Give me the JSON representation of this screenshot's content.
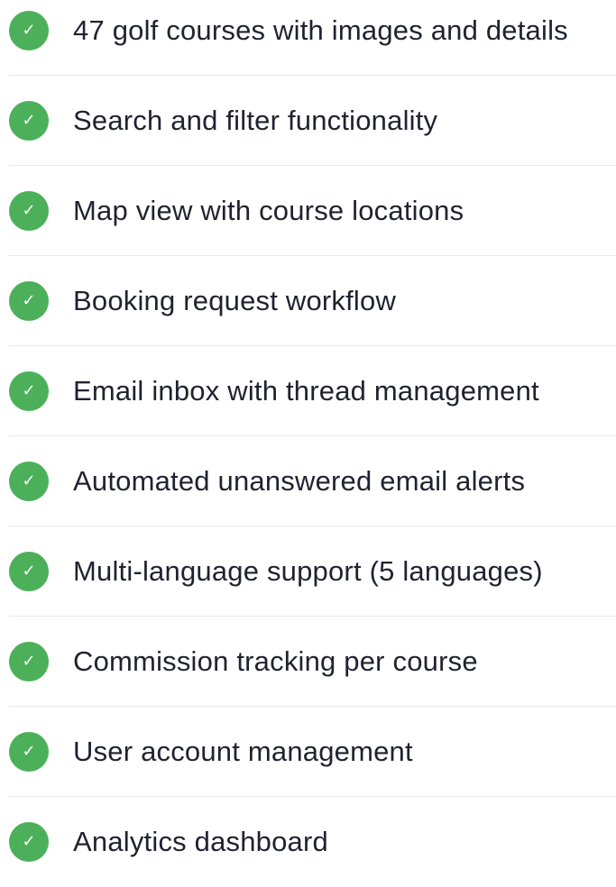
{
  "colors": {
    "check_background": "#4cb05a",
    "check_glyph": "#ffffff",
    "text": "#1f2330",
    "divider": "#e8e9ec"
  },
  "icon": {
    "name": "checkmark-circle-icon",
    "glyph": "✓"
  },
  "features": [
    {
      "label": "47 golf courses with images and details"
    },
    {
      "label": "Search and filter functionality"
    },
    {
      "label": "Map view with course locations"
    },
    {
      "label": "Booking request workflow"
    },
    {
      "label": "Email inbox with thread management"
    },
    {
      "label": "Automated unanswered email alerts"
    },
    {
      "label": "Multi-language support (5 languages)"
    },
    {
      "label": "Commission tracking per course"
    },
    {
      "label": "User account management"
    },
    {
      "label": "Analytics dashboard"
    }
  ]
}
